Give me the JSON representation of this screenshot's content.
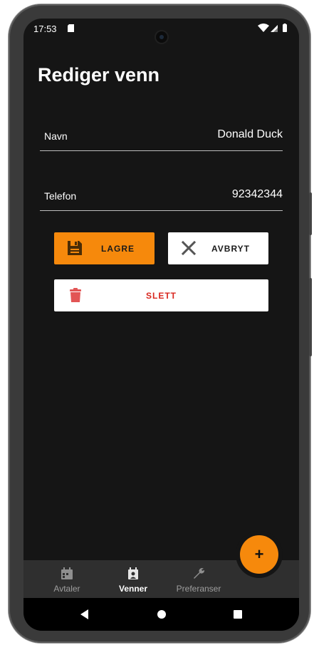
{
  "status_bar": {
    "time": "17:53",
    "icons": [
      "sd-card-icon",
      "wifi-icon",
      "signal-icon",
      "battery-icon"
    ]
  },
  "page": {
    "title": "Rediger venn"
  },
  "form": {
    "fields": [
      {
        "label": "Navn",
        "value": "Donald Duck"
      },
      {
        "label": "Telefon",
        "value": "92342344"
      }
    ]
  },
  "actions": {
    "save_label": "LAGRE",
    "cancel_label": "AVBRYT",
    "delete_label": "SLETT",
    "save_icon": "floppy-disk-icon",
    "cancel_icon": "close-icon",
    "delete_icon": "trash-icon"
  },
  "fab": {
    "label": "+",
    "icon": "plus-icon"
  },
  "bottom_nav": {
    "items": [
      {
        "label": "Avtaler",
        "icon": "calendar-icon",
        "active": false
      },
      {
        "label": "Venner",
        "icon": "people-icon",
        "active": true
      },
      {
        "label": "Preferanser",
        "icon": "wrench-icon",
        "active": false
      }
    ]
  },
  "system_nav": {
    "buttons": [
      "back-icon",
      "home-icon",
      "recents-icon"
    ]
  },
  "colors": {
    "accent": "#f6890c",
    "background": "#151515",
    "danger": "#d9271f",
    "nav_bar": "#2f2f2f",
    "nav_inactive": "#9e9e9e",
    "nav_active": "#ffffff"
  }
}
